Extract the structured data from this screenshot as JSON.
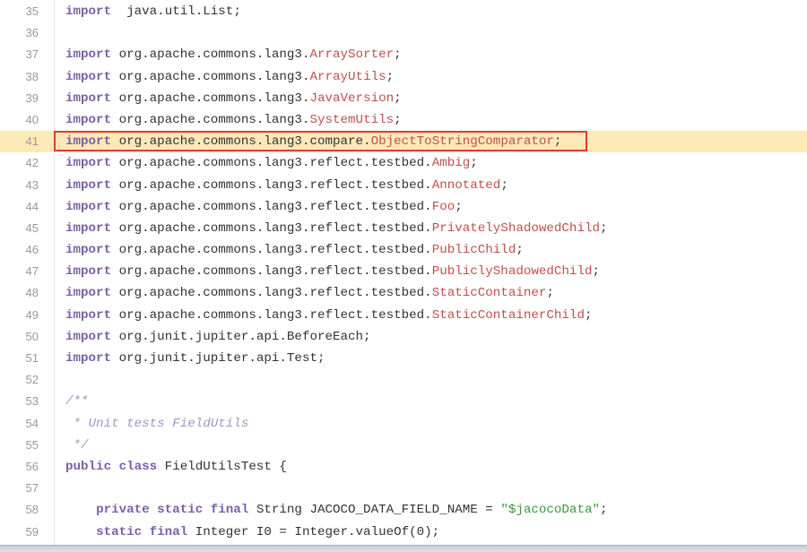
{
  "highlighted_line": 41,
  "lines": [
    {
      "n": "35",
      "t": [
        [
          "kw",
          "import"
        ],
        [
          "",
          "  java.util.List;"
        ]
      ]
    },
    {
      "n": "36",
      "t": []
    },
    {
      "n": "37",
      "t": [
        [
          "kw",
          "import"
        ],
        [
          "",
          " org.apache.commons.lang3."
        ],
        [
          "cls",
          "ArraySorter"
        ],
        [
          "",
          ";"
        ]
      ]
    },
    {
      "n": "38",
      "t": [
        [
          "kw",
          "import"
        ],
        [
          "",
          " org.apache.commons.lang3."
        ],
        [
          "cls",
          "ArrayUtils"
        ],
        [
          "",
          ";"
        ]
      ]
    },
    {
      "n": "39",
      "t": [
        [
          "kw",
          "import"
        ],
        [
          "",
          " org.apache.commons.lang3."
        ],
        [
          "cls",
          "JavaVersion"
        ],
        [
          "",
          ";"
        ]
      ]
    },
    {
      "n": "40",
      "t": [
        [
          "kw",
          "import"
        ],
        [
          "",
          " org.apache.commons.lang3."
        ],
        [
          "cls",
          "SystemUtils"
        ],
        [
          "",
          ";"
        ]
      ]
    },
    {
      "n": "41",
      "t": [
        [
          "kw",
          "import"
        ],
        [
          "",
          " org.apache.commons.lang3.compare."
        ],
        [
          "cls",
          "ObjectToStringComparator"
        ],
        [
          "",
          ";"
        ]
      ]
    },
    {
      "n": "42",
      "t": [
        [
          "kw",
          "import"
        ],
        [
          "",
          " org.apache.commons.lang3.reflect.testbed."
        ],
        [
          "cls",
          "Ambig"
        ],
        [
          "",
          ";"
        ]
      ]
    },
    {
      "n": "43",
      "t": [
        [
          "kw",
          "import"
        ],
        [
          "",
          " org.apache.commons.lang3.reflect.testbed."
        ],
        [
          "cls",
          "Annotated"
        ],
        [
          "",
          ";"
        ]
      ]
    },
    {
      "n": "44",
      "t": [
        [
          "kw",
          "import"
        ],
        [
          "",
          " org.apache.commons.lang3.reflect.testbed."
        ],
        [
          "cls",
          "Foo"
        ],
        [
          "",
          ";"
        ]
      ]
    },
    {
      "n": "45",
      "t": [
        [
          "kw",
          "import"
        ],
        [
          "",
          " org.apache.commons.lang3.reflect.testbed."
        ],
        [
          "cls",
          "PrivatelyShadowedChild"
        ],
        [
          "",
          ";"
        ]
      ]
    },
    {
      "n": "46",
      "t": [
        [
          "kw",
          "import"
        ],
        [
          "",
          " org.apache.commons.lang3.reflect.testbed."
        ],
        [
          "cls",
          "PublicChild"
        ],
        [
          "",
          ";"
        ]
      ]
    },
    {
      "n": "47",
      "t": [
        [
          "kw",
          "import"
        ],
        [
          "",
          " org.apache.commons.lang3.reflect.testbed."
        ],
        [
          "cls",
          "PubliclyShadowedChild"
        ],
        [
          "",
          ";"
        ]
      ]
    },
    {
      "n": "48",
      "t": [
        [
          "kw",
          "import"
        ],
        [
          "",
          " org.apache.commons.lang3.reflect.testbed."
        ],
        [
          "cls",
          "StaticContainer"
        ],
        [
          "",
          ";"
        ]
      ]
    },
    {
      "n": "49",
      "t": [
        [
          "kw",
          "import"
        ],
        [
          "",
          " org.apache.commons.lang3.reflect.testbed."
        ],
        [
          "cls",
          "StaticContainerChild"
        ],
        [
          "",
          ";"
        ]
      ]
    },
    {
      "n": "50",
      "t": [
        [
          "kw",
          "import"
        ],
        [
          "",
          " org.junit.jupiter.api.BeforeEach;"
        ]
      ]
    },
    {
      "n": "51",
      "t": [
        [
          "kw",
          "import"
        ],
        [
          "",
          " org.junit.jupiter.api.Test;"
        ]
      ]
    },
    {
      "n": "52",
      "t": []
    },
    {
      "n": "53",
      "t": [
        [
          "cm",
          "/**"
        ]
      ]
    },
    {
      "n": "54",
      "t": [
        [
          "cm",
          " * Unit tests FieldUtils"
        ]
      ]
    },
    {
      "n": "55",
      "t": [
        [
          "cm",
          " */"
        ]
      ]
    },
    {
      "n": "56",
      "t": [
        [
          "kw",
          "public class"
        ],
        [
          "",
          " FieldUtilsTest {"
        ]
      ]
    },
    {
      "n": "57",
      "t": []
    },
    {
      "n": "58",
      "t": [
        [
          "",
          "    "
        ],
        [
          "kw",
          "private static final"
        ],
        [
          "",
          " String JACOCO_DATA_FIELD_NAME = "
        ],
        [
          "str",
          "\"$jacocoData\""
        ],
        [
          "",
          ";"
        ]
      ]
    },
    {
      "n": "59",
      "t": [
        [
          "",
          "    "
        ],
        [
          "kw",
          "static final"
        ],
        [
          "",
          " Integer I0 = Integer.valueOf(0);"
        ]
      ]
    }
  ]
}
